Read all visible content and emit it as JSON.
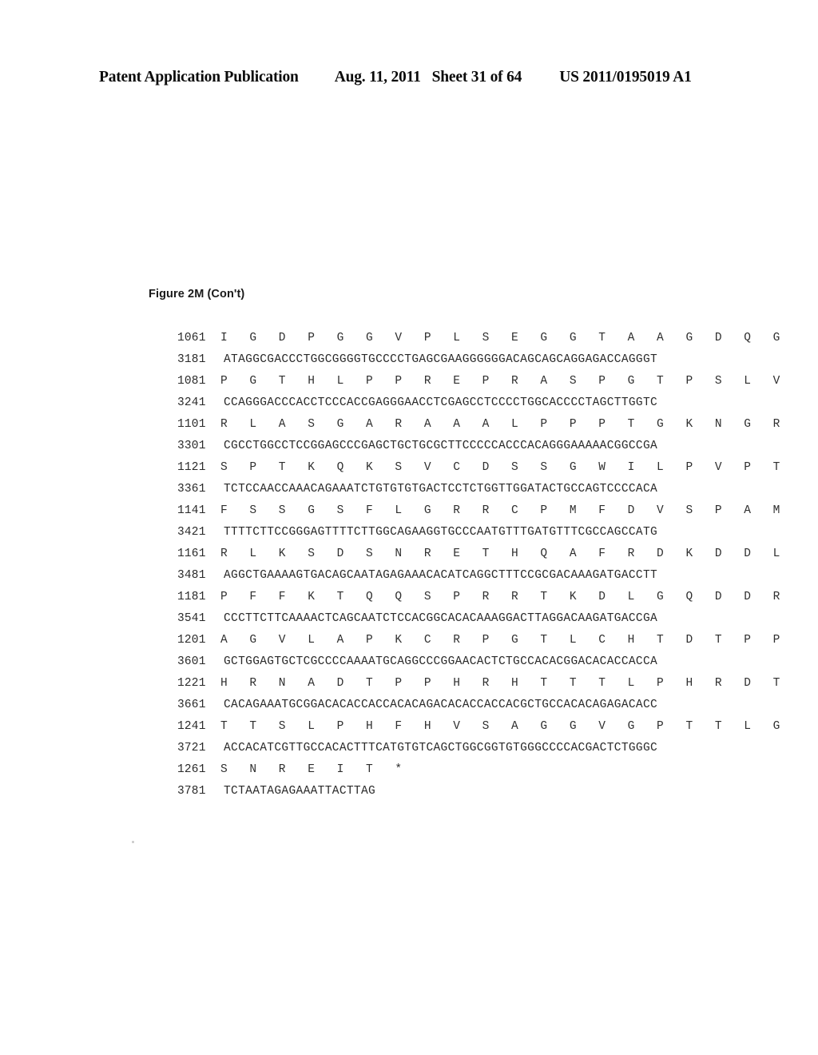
{
  "header": {
    "publication_label": "Patent Application Publication",
    "date": "Aug. 11, 2011",
    "sheet": "Sheet 31 of 64",
    "publication_number": "US 2011/0195019 A1"
  },
  "figure": {
    "caption": "Figure 2M (Con't)"
  },
  "sequence": {
    "lines": [
      {
        "index": "1061",
        "type": "protein",
        "text": "I G D P G G V P L S E G G T A A G D Q G"
      },
      {
        "index": "3181",
        "type": "dna",
        "text": "ATAGGCGACCCTGGCGGGGTGCCCCTGAGCGAAGGGGGGACAGCAGCAGGAGACCAGGGT"
      },
      {
        "index": "1081",
        "type": "protein",
        "text": "P G T H L P P R E P R A S P G T P S L V"
      },
      {
        "index": "3241",
        "type": "dna",
        "text": "CCAGGGACCCACCTCCCACCGAGGGAACCTCGAGCCTCCCCTGGCACCCCTAGCTTGGTC"
      },
      {
        "index": "1101",
        "type": "protein",
        "text": "R L A S G A R A A A L P P P T G K N G R"
      },
      {
        "index": "3301",
        "type": "dna",
        "text": "CGCCTGGCCTCCGGAGCCCGAGCTGCTGCGCTTCCCCCACCCACAGGGAAAAACGGCCGA"
      },
      {
        "index": "1121",
        "type": "protein",
        "text": "S P T K Q K S V C D S S G W I L P V P T"
      },
      {
        "index": "3361",
        "type": "dna",
        "text": "TCTCCAACCAAACAGAAATCTGTGTGTGACTCCTCTGGTTGGATACTGCCAGTCCCCACA"
      },
      {
        "index": "1141",
        "type": "protein",
        "text": "F S S G S F L G R R C P M F D V S P A M"
      },
      {
        "index": "3421",
        "type": "dna",
        "text": "TTTTCTTCCGGGAGTTTTCTTGGCAGAAGGTGCCCAATGTTTGATGTTTCGCCAGCCATG"
      },
      {
        "index": "1161",
        "type": "protein",
        "text": "R L K S D S N R E T H Q A F R D K D D L"
      },
      {
        "index": "3481",
        "type": "dna",
        "text": "AGGCTGAAAAGTGACAGCAATAGAGAAACACATCAGGCTTTCCGCGACAAAGATGACCTT"
      },
      {
        "index": "1181",
        "type": "protein",
        "text": "P F F K T Q Q S P R R T K D L G Q D D R"
      },
      {
        "index": "3541",
        "type": "dna",
        "text": "CCCTTCTTCAAAACTCAGCAATCTCCACGGCACACAAAGGACTTAGGACAAGATGACCGA"
      },
      {
        "index": "1201",
        "type": "protein",
        "text": "A G V L A P K C R P G T L C H T D T P P"
      },
      {
        "index": "3601",
        "type": "dna",
        "text": "GCTGGAGTGCTCGCCCCAAAATGCAGGCCCGGAACACTCTGCCACACGGACACACCACCA"
      },
      {
        "index": "1221",
        "type": "protein",
        "text": "H R N A D T P P H R H T T T L P H R D T"
      },
      {
        "index": "3661",
        "type": "dna",
        "text": "CACAGAAATGCGGACACACCACCACACAGACACACCACCACGCTGCCACACAGAGACACC"
      },
      {
        "index": "1241",
        "type": "protein",
        "text": "T T S L P H F H V S A G G V G P T T L G"
      },
      {
        "index": "3721",
        "type": "dna",
        "text": "ACCACATCGTTGCCACACTTTCATGTGTCAGCTGGCGGTGTGGGCCCCACGACTCTGGGC"
      },
      {
        "index": "1261",
        "type": "protein",
        "text": "S N R E I T *"
      },
      {
        "index": "3781",
        "type": "dna",
        "text": "TCTAATAGAGAAATTACTTAG"
      }
    ]
  }
}
